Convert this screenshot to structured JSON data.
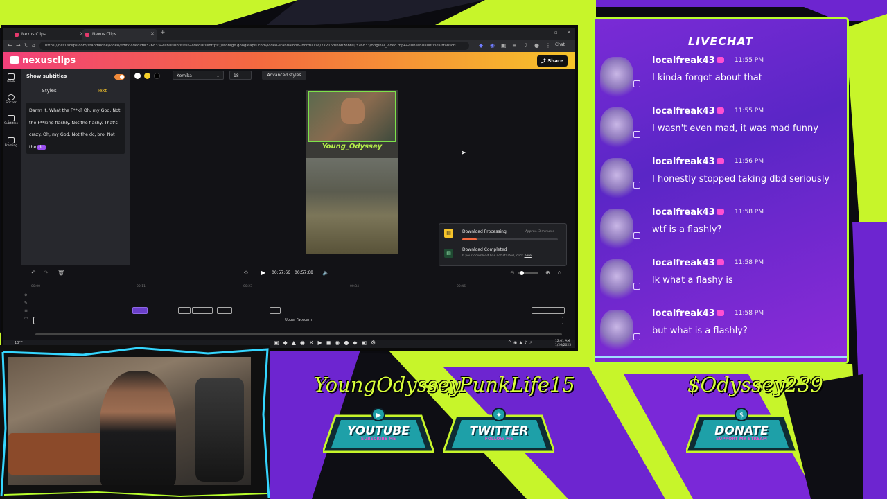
{
  "browser": {
    "tabs": [
      {
        "label": "Nexus Clips"
      },
      {
        "label": "Nexus Clips"
      }
    ],
    "url": "https://nexusclips.com/standalone/video/edit?videoId=376833&tab=subtitles&videoUrl=https://storage.googleapis.com/video-standalone--normalize/772163/horizontal/376833/original_video.mp4&subTab=subtitles-transcri...",
    "chat_label": "Chat"
  },
  "app": {
    "logo": "nexusclips",
    "share_label": "Share",
    "rail": [
      {
        "label": "Hook"
      },
      {
        "label": "Sticker"
      },
      {
        "label": "Subtitles"
      },
      {
        "label": "Framing"
      }
    ],
    "panel": {
      "show_subtitles_label": "Show subtitles",
      "tabs": [
        "Styles",
        "Text"
      ],
      "subtitle_text": "Damn it. What the F**k? Oh, my God. Not the F**king flashly. Not the flashy. That's crazy. Oh, my God. Not the dc, bro. Not the",
      "subtitle_highlight": "dc."
    },
    "toolbar": {
      "font": "Komika",
      "size": "18",
      "advanced_label": "Advanced styles"
    },
    "preview": {
      "overlay_name": "Young_Odyssey"
    },
    "downloads": {
      "processing_title": "Download Processing",
      "processing_eta": "Approx. 3 minutes",
      "processing_progress": 0.15,
      "completed_title": "Download Completed",
      "completed_sub": "If your download has not started, click",
      "completed_link": "here"
    },
    "player": {
      "current_time": "00:57:66",
      "total_time": "00:57:68"
    },
    "timeline": {
      "ticks": [
        "00:00",
        "00:11",
        "00:23",
        "00:34",
        "00:46"
      ],
      "track_label": "Upper Facecam"
    },
    "taskbar": {
      "temp": "13°F",
      "time": "12:01 AM",
      "date": "1/26/2025"
    }
  },
  "chat": {
    "header": "LIVECHAT",
    "messages": [
      {
        "user": "localfreak43",
        "time": "11:55 PM",
        "text": "I kinda forgot about that"
      },
      {
        "user": "localfreak43",
        "time": "11:55 PM",
        "text": "I wasn't even mad, it was mad funny"
      },
      {
        "user": "localfreak43",
        "time": "11:56 PM",
        "text": "I honestly stopped taking dbd seriously"
      },
      {
        "user": "localfreak43",
        "time": "11:58 PM",
        "text": "wtf is a flashly?"
      },
      {
        "user": "localfreak43",
        "time": "11:58 PM",
        "text": "lk what a flashy is"
      },
      {
        "user": "localfreak43",
        "time": "11:58 PM",
        "text": "but what is a flashly?"
      }
    ]
  },
  "socials": {
    "youtube_handle": "YoungOdyssey",
    "twitter_handle": "PunkLife15",
    "cashapp_handle": "$Odyssey239",
    "youtube_label": "YOUTUBE",
    "youtube_sub": "SUBSCRIBE ME",
    "twitter_label": "TWITTER",
    "twitter_sub": "FOLLOW ME",
    "donate_label": "DONATE",
    "donate_sub": "SUPPORT MY STREAM"
  },
  "colors": {
    "accent_lime": "#b9ff2d",
    "chat_purple": "#6b28d0",
    "brand_pink": "#f2407a",
    "brand_yellow": "#f6c42a"
  }
}
